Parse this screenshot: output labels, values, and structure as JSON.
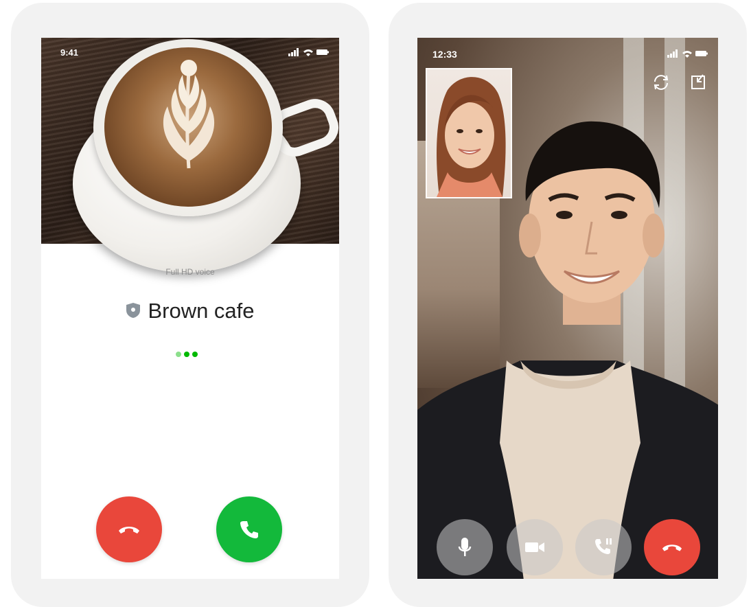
{
  "left_phone": {
    "status_bar": {
      "time": "9:41"
    },
    "call_quality": "Full HD voice",
    "caller_name": "Brown cafe",
    "caller_badge_icon": "shield-icon",
    "ringing_dots": 3,
    "buttons": {
      "decline_icon": "phone-hangup-icon",
      "accept_icon": "phone-icon"
    }
  },
  "right_phone": {
    "status_bar": {
      "time": "12:33"
    },
    "top_icons": [
      "camera-switch-icon",
      "minimize-icon"
    ],
    "controls": [
      "microphone-icon",
      "video-camera-icon",
      "pause-call-icon",
      "phone-hangup-icon"
    ]
  },
  "colors": {
    "decline": "#e9473b",
    "accept": "#13b93b",
    "ringing_dot": "#00b900",
    "card_bg": "#f2f2f2"
  }
}
